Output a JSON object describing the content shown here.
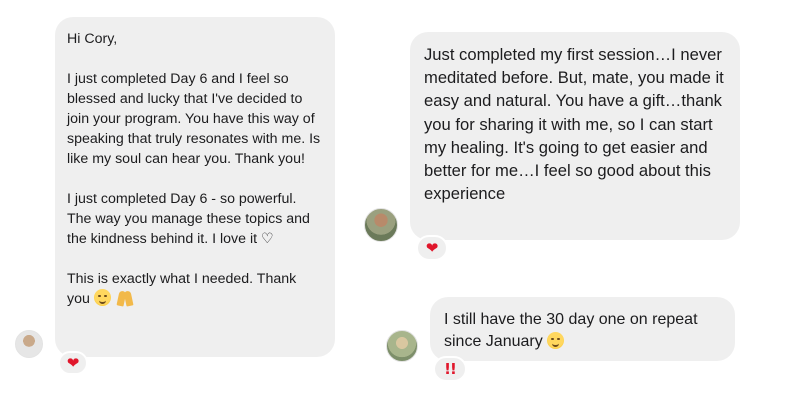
{
  "left_message": {
    "greeting": "Hi Cory,",
    "paragraph_1": "I just completed Day 6 and I feel so blessed and lucky that I've decided to join your program. You have this way of speaking that truly resonates with me. Is like my soul can hear you. Thank you!",
    "paragraph_2": "I just completed Day 6 - so powerful. The way you manage these topics and the kindness behind it. I love it ♡",
    "paragraph_3": "This is exactly what I needed. Thank you",
    "reaction": "❤"
  },
  "right_message_1": {
    "text": "Just completed my first session…I never meditated before. But, mate, you made it easy and natural. You have a gift…thank you for sharing it with me, so I can start my healing. It's going to get easier and better for me…I feel so good about this experience",
    "reaction": "❤"
  },
  "right_message_2": {
    "text": "I still have the 30 day one on repeat since January",
    "reaction": "!!"
  },
  "icons": {
    "heart": "heart-icon",
    "double_exclamation": "double-exclamation-icon",
    "smile": "smiling-face-icon",
    "pray": "folded-hands-icon",
    "relieved": "relieved-face-icon"
  },
  "colors": {
    "bubble": "#efefef",
    "reaction_red": "#e0162b"
  }
}
